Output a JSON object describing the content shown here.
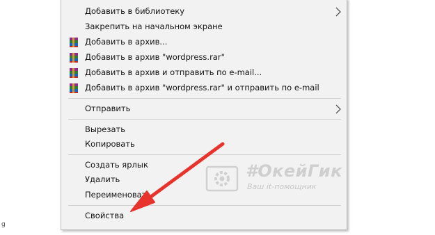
{
  "menu": {
    "items": [
      {
        "label": "Добавить в библиотеку",
        "has_submenu": true,
        "icon": ""
      },
      {
        "label": "Закрепить на начальном экране",
        "has_submenu": false,
        "icon": ""
      },
      {
        "label": "Добавить в архив...",
        "has_submenu": false,
        "icon": "winrar-icon"
      },
      {
        "label": "Добавить в архив \"wordpress.rar\"",
        "has_submenu": false,
        "icon": "winrar-icon"
      },
      {
        "label": "Добавить в архив и отправить по e-mail...",
        "has_submenu": false,
        "icon": "winrar-icon"
      },
      {
        "label": "Добавить в архив \"wordpress.rar\" и отправить по e-mail",
        "has_submenu": false,
        "icon": "winrar-icon"
      },
      {
        "label": "Отправить",
        "has_submenu": true,
        "icon": ""
      },
      {
        "label": "Вырезать",
        "has_submenu": false,
        "icon": ""
      },
      {
        "label": "Копировать",
        "has_submenu": false,
        "icon": ""
      },
      {
        "label": "Создать ярлык",
        "has_submenu": false,
        "icon": ""
      },
      {
        "label": "Удалить",
        "has_submenu": false,
        "icon": ""
      },
      {
        "label": "Переименовать",
        "has_submenu": false,
        "icon": ""
      },
      {
        "label": "Свойства",
        "has_submenu": false,
        "icon": ""
      }
    ]
  },
  "watermark": {
    "title": "#ОкейГик",
    "subtitle": "Ваш it-помощник"
  },
  "left_edge_glyph": "g",
  "colors": {
    "menu_background": "#f2f2f2",
    "arrow": "#e8322c",
    "watermark": "#cfcfcf"
  }
}
